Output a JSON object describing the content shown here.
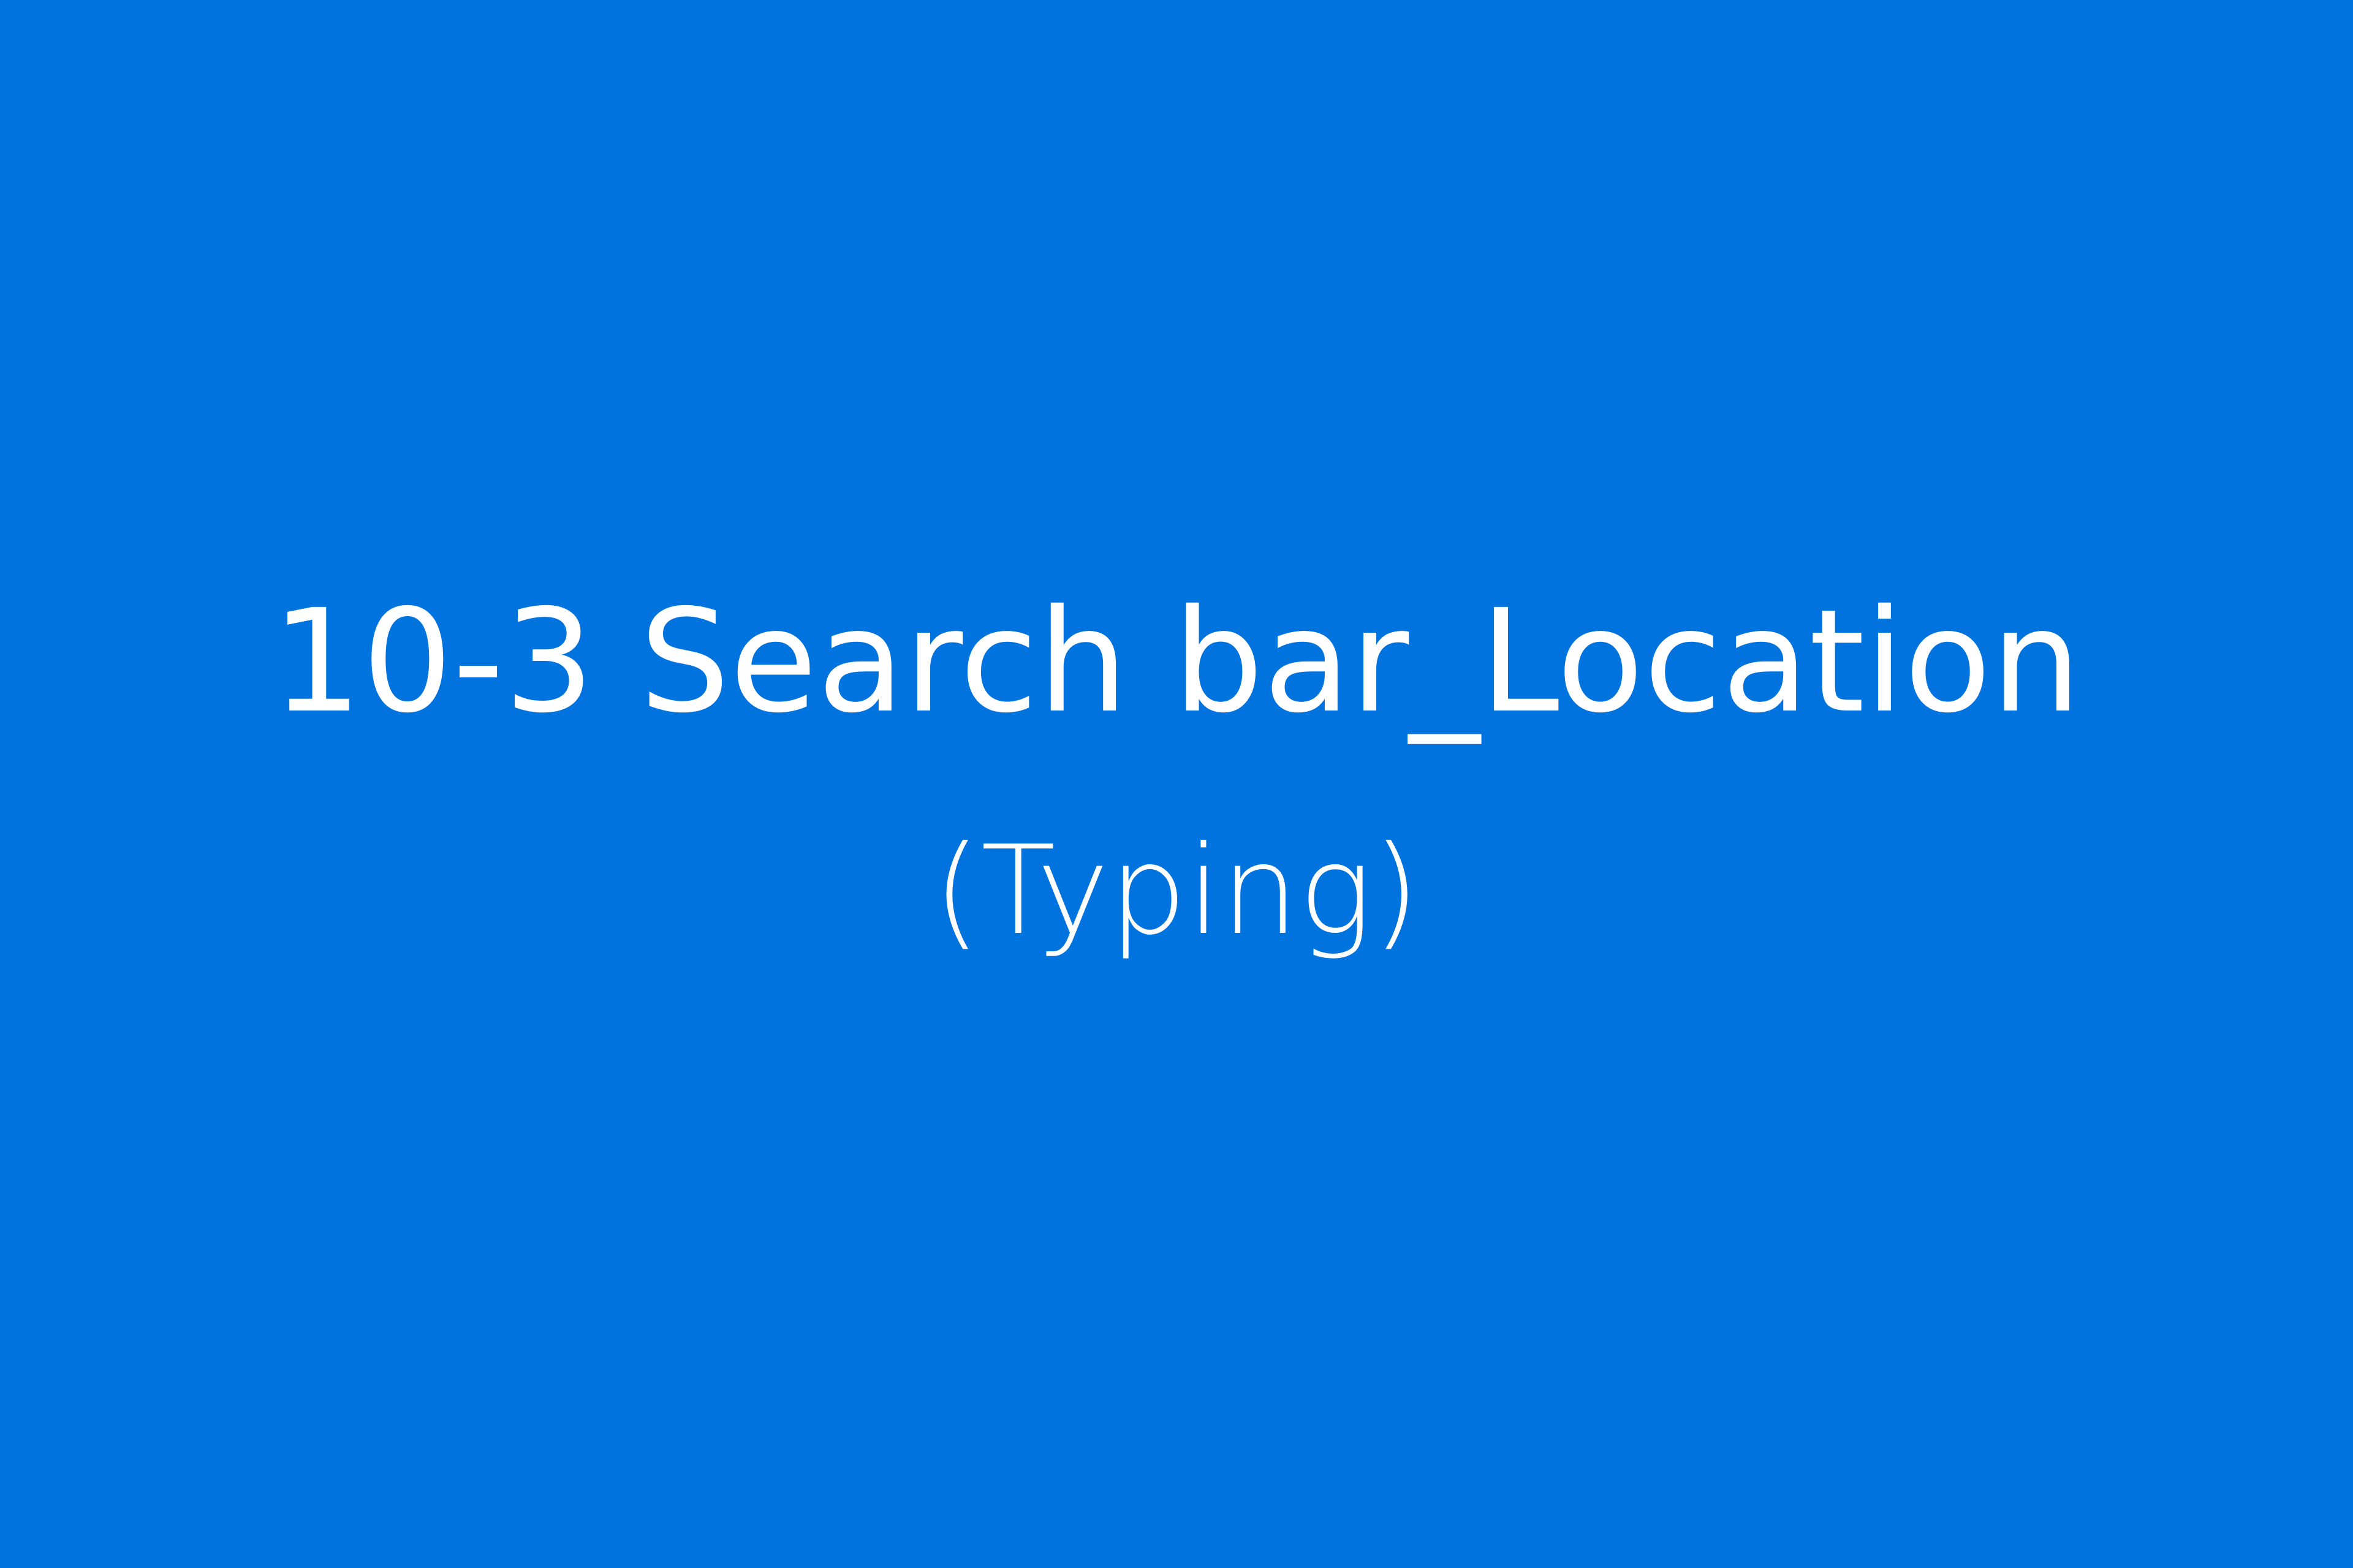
{
  "slide": {
    "background_color": "#0073df",
    "text_color": "#ffffff",
    "title": "10-3 Search bar_Location",
    "subtitle": "(Typing)"
  }
}
